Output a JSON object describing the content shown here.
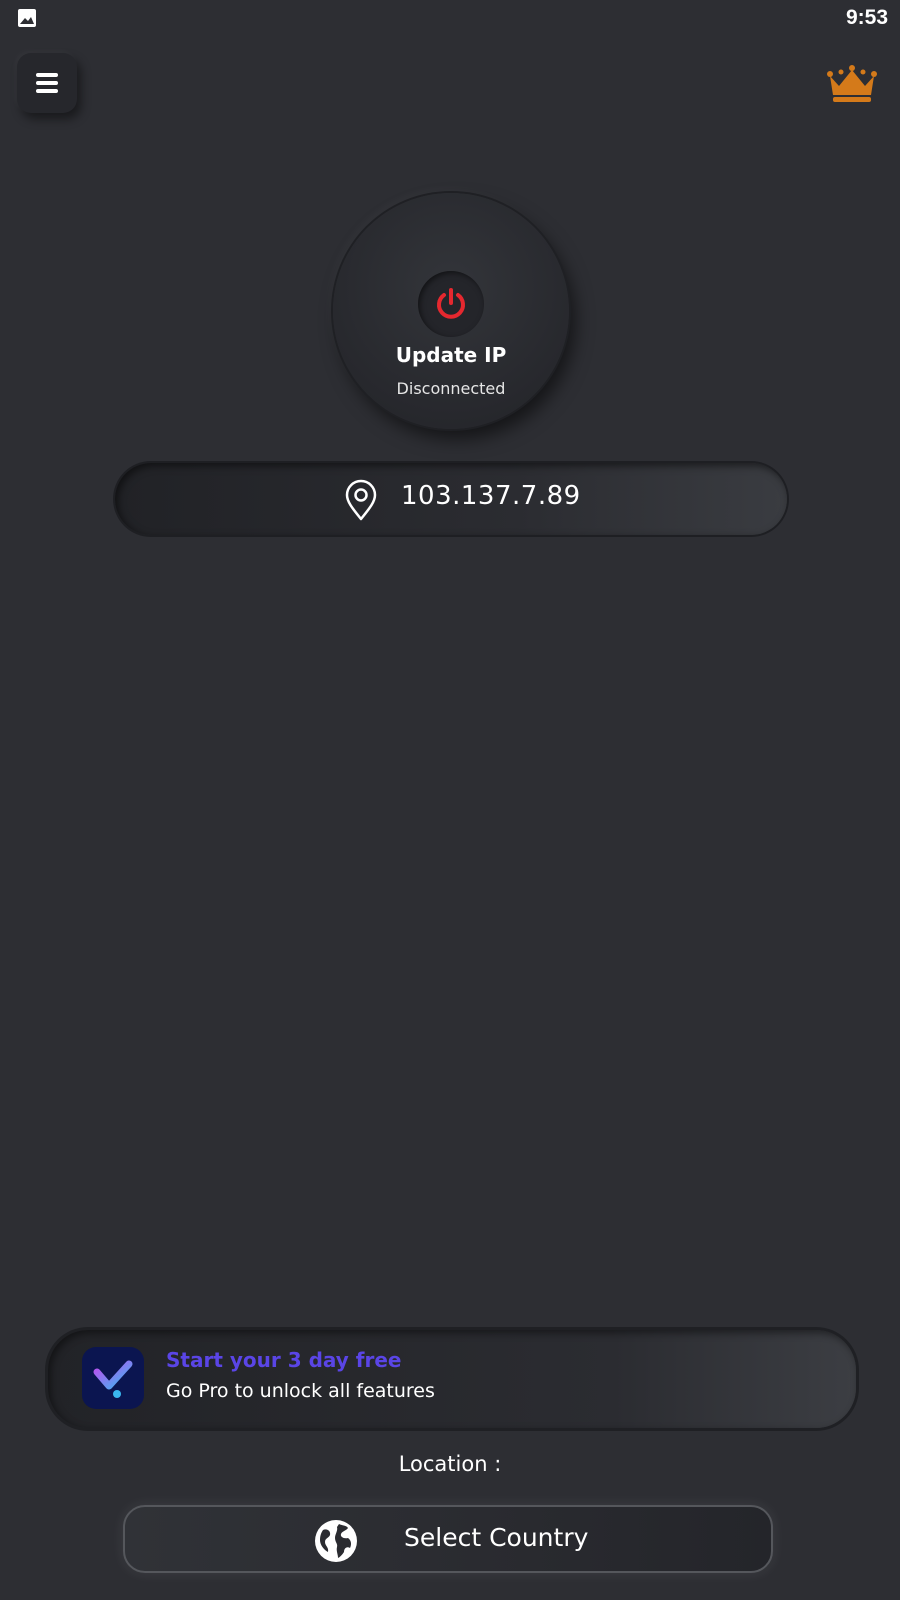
{
  "status_bar": {
    "time": "9:53",
    "left_icon": "image-icon"
  },
  "header": {
    "menu_icon": "hamburger-menu-icon",
    "premium_icon": "crown-icon",
    "premium_color": "#d47a1a"
  },
  "connect": {
    "title": "Update IP",
    "status": "Disconnected",
    "power_icon": "power-icon",
    "power_color": "#e5282f"
  },
  "ip_display": {
    "icon": "location-pin-icon",
    "value": "103.137.7.89"
  },
  "promo": {
    "icon": "app-check-icon",
    "title": "Start your 3 day free",
    "subtitle": "Go Pro to unlock all features",
    "title_color": "#5a45e6"
  },
  "location": {
    "label": "Location :",
    "button_icon": "globe-icon",
    "button_label": "Select Country"
  }
}
